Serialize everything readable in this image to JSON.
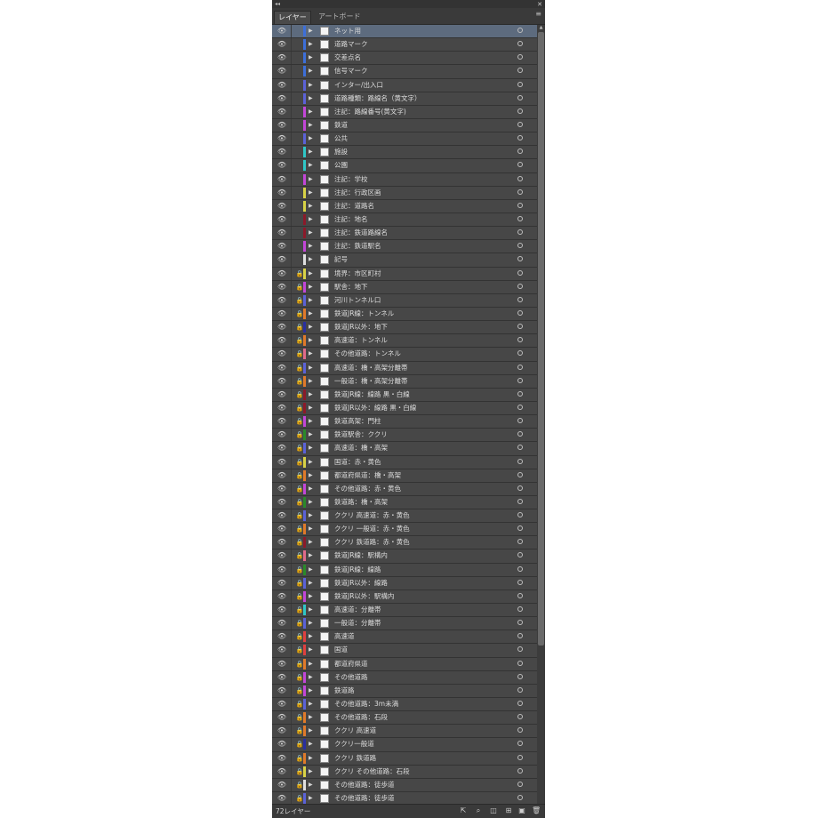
{
  "tabs": {
    "layers": "レイヤー",
    "artboards": "アートボード"
  },
  "icons": {
    "eye": "eye-icon",
    "lock": "lock-icon",
    "expand": "expand-arrow-icon",
    "target": "target-circle-icon",
    "menu": "panel-menu-icon"
  },
  "status": {
    "layer_count": "72レイヤー"
  },
  "layers": [
    {
      "name": "ネット用",
      "color": "#3d6fd9",
      "locked": false,
      "selected": true
    },
    {
      "name": "道路マーク",
      "color": "#3d6fd9",
      "locked": false,
      "selected": false
    },
    {
      "name": "交差点名",
      "color": "#3d6fd9",
      "locked": false,
      "selected": false
    },
    {
      "name": "信号マーク",
      "color": "#3d6fd9",
      "locked": false,
      "selected": false
    },
    {
      "name": "インター/出入口",
      "color": "#5b62d8",
      "locked": false,
      "selected": false
    },
    {
      "name": "道路種類：路線名（黄文字）",
      "color": "#5b62d8",
      "locked": false,
      "selected": false
    },
    {
      "name": "注記：路線番号(黄文字)",
      "color": "#c346d8",
      "locked": false,
      "selected": false
    },
    {
      "name": "鉄道",
      "color": "#c346d8",
      "locked": false,
      "selected": false
    },
    {
      "name": "公共",
      "color": "#5b62d8",
      "locked": false,
      "selected": false
    },
    {
      "name": "施設",
      "color": "#2fc7c7",
      "locked": false,
      "selected": false
    },
    {
      "name": "公園",
      "color": "#2fc7c7",
      "locked": false,
      "selected": false
    },
    {
      "name": "注記：学校",
      "color": "#c346d8",
      "locked": false,
      "selected": false
    },
    {
      "name": "注記：行政区画",
      "color": "#d8d246",
      "locked": false,
      "selected": false
    },
    {
      "name": "注記：道路名",
      "color": "#d8d246",
      "locked": false,
      "selected": false
    },
    {
      "name": "注記：地名",
      "color": "#8b1a2a",
      "locked": false,
      "selected": false
    },
    {
      "name": "注記：鉄道路線名",
      "color": "#8b1a2a",
      "locked": false,
      "selected": false
    },
    {
      "name": "注記：鉄道駅名",
      "color": "#c346d8",
      "locked": false,
      "selected": false
    },
    {
      "name": "記号",
      "color": "#e0e0e0",
      "locked": false,
      "selected": false
    },
    {
      "name": "境界：市区町村",
      "color": "#d8d246",
      "locked": true,
      "selected": false
    },
    {
      "name": "駅舎：地下",
      "color": "#c346d8",
      "locked": true,
      "selected": false
    },
    {
      "name": "河川トンネル口",
      "color": "#5b62d8",
      "locked": true,
      "selected": false
    },
    {
      "name": "鉄道JR線：トンネル",
      "color": "#e07a2a",
      "locked": true,
      "selected": false
    },
    {
      "name": "鉄道JR以外：地下",
      "color": "#2a2fa0",
      "locked": true,
      "selected": false
    },
    {
      "name": "高速道：トンネル",
      "color": "#e07a2a",
      "locked": true,
      "selected": false
    },
    {
      "name": "その他道路：トンネル",
      "color": "#e06a8a",
      "locked": true,
      "selected": false
    },
    {
      "name": "高速道：橋・高架分離帯",
      "color": "#5b62d8",
      "locked": true,
      "selected": false
    },
    {
      "name": "一般道：橋・高架分離帯",
      "color": "#e07a2a",
      "locked": true,
      "selected": false
    },
    {
      "name": "鉄道JR線：線路 黒・白線",
      "color": "#8b1a2a",
      "locked": true,
      "selected": false
    },
    {
      "name": "鉄道JR以外：線路 黒・白線",
      "color": "#8b1a2a",
      "locked": true,
      "selected": false
    },
    {
      "name": "鉄道高架：門柱",
      "color": "#c346d8",
      "locked": true,
      "selected": false
    },
    {
      "name": "鉄道駅舎：ククリ",
      "color": "#2a8a2a",
      "locked": true,
      "selected": false
    },
    {
      "name": "高速道：橋・高架",
      "color": "#5b62d8",
      "locked": true,
      "selected": false
    },
    {
      "name": "国道：赤・黄色",
      "color": "#d8d246",
      "locked": true,
      "selected": false
    },
    {
      "name": "都道府県道：橋・高架",
      "color": "#e07a2a",
      "locked": true,
      "selected": false
    },
    {
      "name": "その他道路：赤・黄色",
      "color": "#c346d8",
      "locked": true,
      "selected": false
    },
    {
      "name": "鉄道路：橋・高架",
      "color": "#2a8a2a",
      "locked": true,
      "selected": false
    },
    {
      "name": "ククリ 高速道：赤・黄色",
      "color": "#5b62d8",
      "locked": true,
      "selected": false
    },
    {
      "name": "ククリ 一般道：赤・黄色",
      "color": "#e07a2a",
      "locked": true,
      "selected": false
    },
    {
      "name": "ククリ 鉄道路：赤・黄色",
      "color": "#8b1a2a",
      "locked": true,
      "selected": false
    },
    {
      "name": "鉄道JR線：駅構内",
      "color": "#e06a8a",
      "locked": true,
      "selected": false
    },
    {
      "name": "鉄道JR線：線路",
      "color": "#2a8a2a",
      "locked": true,
      "selected": false
    },
    {
      "name": "鉄道JR以外：線路",
      "color": "#5b62d8",
      "locked": true,
      "selected": false
    },
    {
      "name": "鉄道JR以外：駅構内",
      "color": "#c346d8",
      "locked": true,
      "selected": false
    },
    {
      "name": "高速道：分離帯",
      "color": "#2fc7c7",
      "locked": true,
      "selected": false
    },
    {
      "name": "一般道：分離帯",
      "color": "#5b62d8",
      "locked": true,
      "selected": false
    },
    {
      "name": "高速道",
      "color": "#e04040",
      "locked": true,
      "selected": false
    },
    {
      "name": "国道",
      "color": "#e04040",
      "locked": true,
      "selected": false
    },
    {
      "name": "都道府県道",
      "color": "#e07a2a",
      "locked": true,
      "selected": false
    },
    {
      "name": "その他道路",
      "color": "#c346d8",
      "locked": true,
      "selected": false
    },
    {
      "name": "鉄道路",
      "color": "#c346d8",
      "locked": true,
      "selected": false
    },
    {
      "name": "その他道路：3m未満",
      "color": "#5b62d8",
      "locked": true,
      "selected": false
    },
    {
      "name": "その他道路：石段",
      "color": "#e07a2a",
      "locked": true,
      "selected": false
    },
    {
      "name": "ククリ 高速道",
      "color": "#e07a2a",
      "locked": true,
      "selected": false
    },
    {
      "name": "ククリ一般道",
      "color": "#2a2fa0",
      "locked": true,
      "selected": false
    },
    {
      "name": "ククリ 鉄道路",
      "color": "#e07a2a",
      "locked": true,
      "selected": false
    },
    {
      "name": "ククリ その他道路：石段",
      "color": "#d8d246",
      "locked": true,
      "selected": false
    },
    {
      "name": "その他道路：徒歩道",
      "color": "#e0e0e0",
      "locked": true,
      "selected": false
    },
    {
      "name": "その他道路：徒歩道",
      "color": "#5b62d8",
      "locked": true,
      "selected": false
    }
  ]
}
